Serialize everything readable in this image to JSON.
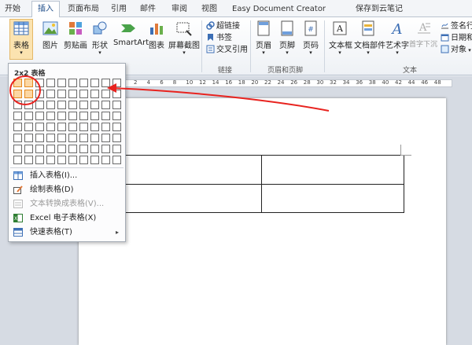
{
  "tabs": [
    {
      "label": "开始",
      "active": false
    },
    {
      "label": "插入",
      "active": true
    },
    {
      "label": "页面布局",
      "active": false
    },
    {
      "label": "引用",
      "active": false
    },
    {
      "label": "邮件",
      "active": false
    },
    {
      "label": "审阅",
      "active": false
    },
    {
      "label": "视图",
      "active": false
    },
    {
      "label": "Easy Document Creator",
      "active": false
    },
    {
      "label": "保存到云笔记",
      "active": false
    }
  ],
  "ribbon": {
    "table_label": "表格",
    "picture": "图片",
    "clipart": "剪贴画",
    "shapes": "形状",
    "smartart": "SmartArt",
    "chart": "图表",
    "screenshot": "屏幕截图",
    "hyperlink": "超链接",
    "bookmark": "书签",
    "crossref": "交叉引用",
    "links_group": "链接",
    "header": "页眉",
    "footer": "页脚",
    "page_number": "页码",
    "header_footer_group": "页眉和页脚",
    "textbox": "文本框",
    "quickparts": "文档部件",
    "wordart": "艺术字",
    "dropcap": "首字下沉",
    "signature": "签名行",
    "datetime": "日期和",
    "object": "对象",
    "text_group": "文本"
  },
  "dropdown": {
    "title": "2x2 表格",
    "grid": {
      "columns": 10,
      "rows": 8,
      "selected_cols": 2,
      "selected_rows": 2
    },
    "items": [
      {
        "label": "插入表格(I)...",
        "enabled": true,
        "submenu": false
      },
      {
        "label": "绘制表格(D)",
        "enabled": true,
        "submenu": false
      },
      {
        "label": "文本转换成表格(V)...",
        "enabled": false,
        "submenu": false
      },
      {
        "label": "Excel 电子表格(X)",
        "enabled": true,
        "submenu": false
      },
      {
        "label": "快速表格(T)",
        "enabled": true,
        "submenu": true
      }
    ]
  },
  "ruler": {
    "ticks": [
      "2",
      "4",
      "6",
      "8",
      "10",
      "12",
      "14",
      "16",
      "18",
      "20",
      "22",
      "24",
      "26",
      "28",
      "30",
      "32",
      "34",
      "36",
      "38",
      "40",
      "42",
      "44",
      "46",
      "48"
    ]
  },
  "document_table": {
    "rows": 2,
    "columns": 2
  },
  "colors": {
    "annotation": "#e8231f",
    "grid_highlight": "#fcd7a3",
    "accent": "#1f4e8a"
  },
  "icons": {
    "submenu_arrow": "▸"
  }
}
